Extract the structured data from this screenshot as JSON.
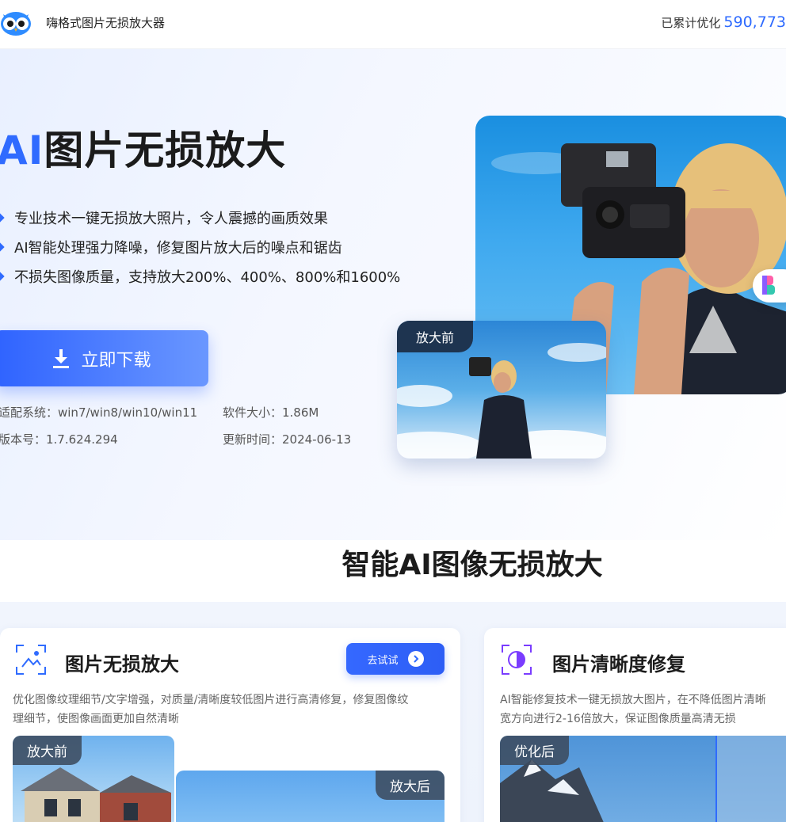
{
  "header": {
    "brand": "嗨格式图片无损放大器",
    "counter_label": "已累计优化",
    "counter_value": "590,773"
  },
  "hero": {
    "title_ai": "AI",
    "title_rest": "图片无损放大",
    "bullets": [
      "专业技术一键无损放大照片，令人震撼的画质效果",
      "AI智能处理强力降噪，修复图片放大后的噪点和锯齿",
      "不损失图像质量，支持放大200%、400%、800%和1600%"
    ],
    "download_label": "立即下载",
    "system": "适配系统：win7/win8/win10/win11",
    "size": "软件大小：1.86M",
    "version": "版本号：1.7.624.294",
    "updated": "更新时间：2024-06-13",
    "before_tag": "放大前"
  },
  "section_title": "智能AI图像无损放大",
  "cards": [
    {
      "title": "图片无损放大",
      "try_label": "去试试",
      "desc_line1": "优化图像纹理细节/文字增强，对质量/清晰度较低图片进行高清修复，修复图像纹",
      "desc_line2": "理细节，使图像画面更加自然清晰",
      "before_tag": "放大前",
      "after_tag": "放大后"
    },
    {
      "title": "图片清晰度修复",
      "desc_line1": "AI智能修复技术一键无损放大图片，在不降低图片清晰",
      "desc_line2": "宽方向进行2-16倍放大，保证图像质量高清无损",
      "opt_tag": "优化后"
    }
  ],
  "colors": {
    "accent": "#2f6bff",
    "dark_tag": "#1e3450"
  }
}
